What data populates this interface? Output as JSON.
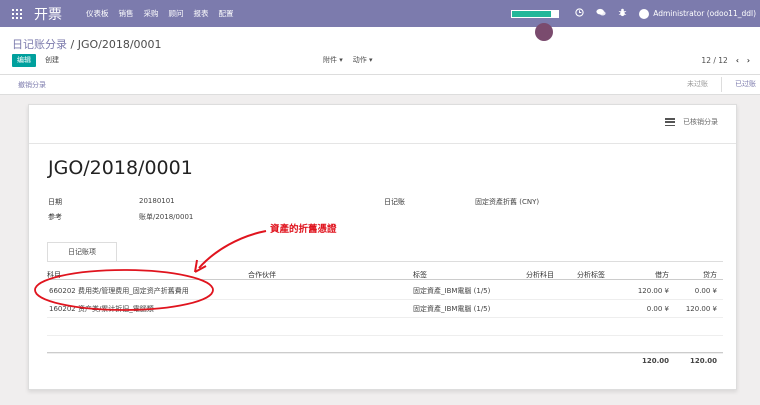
{
  "topbar": {
    "brand": "开票",
    "menu": [
      "仪表板",
      "销售",
      "采购",
      "顾问",
      "报表",
      "配置"
    ],
    "user": "Administrator (odoo11_ddl)",
    "progress": 0.85
  },
  "control": {
    "breadcrumb_parent": "日记账分录",
    "breadcrumb_sep": "/",
    "breadcrumb_current": "JGO/2018/0001",
    "edit_label": "编辑",
    "create_label": "创建",
    "attachment_label": "附件",
    "action_label": "动作",
    "pager": "12 / 12",
    "prev": "‹",
    "next": "›"
  },
  "statusbar": {
    "cancel_label": "撤销分录",
    "stage_draft": "未过账",
    "stage_posted": "已过账"
  },
  "sheet": {
    "reconciled_label": "已核销分录",
    "title": "JGO/2018/0001",
    "date_label": "日期",
    "date_value": "20180101",
    "ref_label": "参考",
    "ref_value": "账单/2018/0001",
    "journal_label": "日记账",
    "journal_value": "固定资產折舊 (CNY)",
    "tab_label": "日记账项",
    "annotation": "資產的折舊憑證"
  },
  "table": {
    "headers": {
      "account": "科目",
      "partner": "合作伙伴",
      "label": "标签",
      "analytic_account": "分析科目",
      "analytic_tags": "分析标签",
      "debit": "借方",
      "credit": "贷方"
    },
    "rows": [
      {
        "account": "660202 费用类/管理费用_固定资产折舊費用",
        "partner": "",
        "label": "固定資產_IBM電腦 (1/5)",
        "debit": "120.00 ¥",
        "credit": "0.00 ¥"
      },
      {
        "account": "160202 资产类/累计折旧_電腦類",
        "partner": "",
        "label": "固定資產_IBM電腦 (1/5)",
        "debit": "0.00 ¥",
        "credit": "120.00 ¥"
      }
    ],
    "total_debit": "120.00",
    "total_credit": "120.00"
  },
  "colors": {
    "brand_purple": "#7c7bad",
    "edit_teal": "#00a09d",
    "annotation_red": "#e0141e"
  }
}
